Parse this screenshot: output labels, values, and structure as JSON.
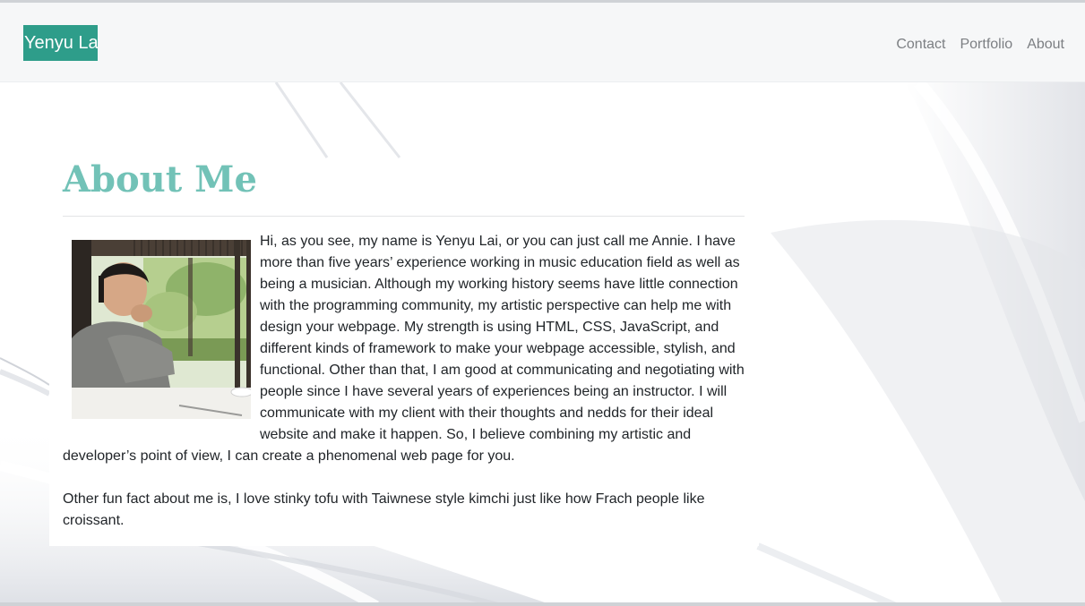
{
  "navbar": {
    "brand": "Yenyu Lai",
    "links": [
      "Contact",
      "Portfolio",
      "About"
    ]
  },
  "main": {
    "title": "About Me",
    "paragraphs": [
      "Hi, as you see, my name is Yenyu Lai, or you can just call me Annie. I have more than five years’ experience working in music education field as well as being a musician. Although my working history seems have little connection with the programming community, my artistic perspective can help me with design your webpage. My strength is using HTML, CSS, JavaScript, and different kinds of framework to make your webpage accessible, stylish, and functional. Other than that, I am good at communicating and negotiating with people since I have several years of experiences being an instructor. I will communicate with my client with their thoughts and nedds for their ideal website and make it happen. So, I believe combining my artistic and developer’s point of view, I can create a phenomenal web page for you.",
      "Other fun fact about me is, I love stinky tofu with Taiwnese style kimchi just like how Frach people like croissant."
    ]
  },
  "colors": {
    "brand_bg": "#2e9d8a",
    "title": "#72c2b7",
    "nav_link": "#7c7f83",
    "navbar_bg": "#f6f7f8",
    "body_text": "#212529"
  }
}
